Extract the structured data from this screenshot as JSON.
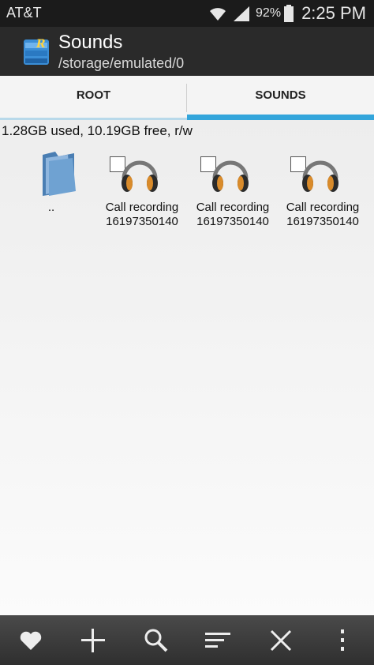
{
  "status_bar": {
    "carrier": "AT&T",
    "battery_percent": "92%",
    "time": "2:25 PM",
    "icons": [
      "wifi-icon",
      "signal-icon",
      "battery-icon"
    ]
  },
  "app_bar": {
    "title": "Sounds",
    "path": "/storage/emulated/0",
    "icon": "root-explorer-app-icon"
  },
  "tabs": [
    {
      "label": "ROOT",
      "selected": false
    },
    {
      "label": "SOUNDS",
      "selected": true
    }
  ],
  "storage_info": "1.28GB used, 10.19GB free, r/w",
  "files": [
    {
      "name": "..",
      "type": "folder",
      "icon": "folder-icon"
    },
    {
      "name_line1": "Call recording",
      "name_line2": "16197350140",
      "type": "audio",
      "icon": "headphones-icon"
    },
    {
      "name_line1": "Call recording",
      "name_line2": "16197350140",
      "type": "audio",
      "icon": "headphones-icon"
    },
    {
      "name_line1": "Call recording",
      "name_line2": "16197350140",
      "type": "audio",
      "icon": "headphones-icon"
    }
  ],
  "toolbar": [
    "heart-icon",
    "plus-icon",
    "search-icon",
    "sort-icon",
    "close-icon",
    "overflow-menu-icon"
  ],
  "colors": {
    "tab_indicator": "#33a5db",
    "app_bar_bg": "#2a2a2a",
    "status_bar_bg": "#1b1b1b",
    "toolbar_bg": "#3a3a3a"
  }
}
